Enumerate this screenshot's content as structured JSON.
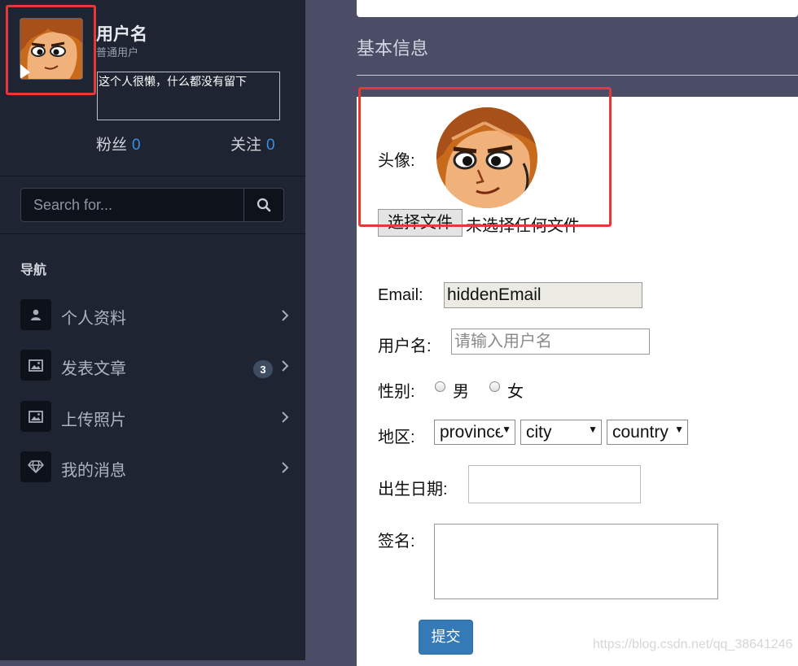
{
  "sidebar": {
    "username": "用户名",
    "role": "普通用户",
    "bio": "这个人很懒，什么都没有留下",
    "fans_label": "粉丝",
    "fans_count": "0",
    "follow_label": "关注",
    "follow_count": "0",
    "search_placeholder": "Search for...",
    "nav_heading": "导航",
    "nav_items": [
      {
        "label": "个人资料",
        "icon": "user-icon"
      },
      {
        "label": "发表文章",
        "icon": "image-icon",
        "badge": "3"
      },
      {
        "label": "上传照片",
        "icon": "image-icon"
      },
      {
        "label": "我的消息",
        "icon": "diamond-icon"
      }
    ]
  },
  "main": {
    "section_title": "基本信息",
    "form": {
      "avatar_label": "头像:",
      "file_button": "选择文件",
      "file_status": "未选择任何文件",
      "email_label": "Email:",
      "email_value": "hiddenEmail",
      "username_label": "用户名:",
      "username_placeholder": "请输入用户名",
      "gender_label": "性别:",
      "gender_options": [
        "男",
        "女"
      ],
      "region_label": "地区:",
      "region_selects": [
        "province",
        "city",
        "country"
      ],
      "birthday_label": "出生日期:",
      "signature_label": "签名:",
      "submit_label": "提交"
    }
  },
  "watermark": "https://blog.csdn.net/qq_38641246",
  "colors": {
    "sidebar_bg": "#1e2431",
    "main_bg": "#4b4c66",
    "accent_blue": "#3b8fe0",
    "submit_bg": "#337ab7",
    "highlight_red": "#e53935"
  }
}
